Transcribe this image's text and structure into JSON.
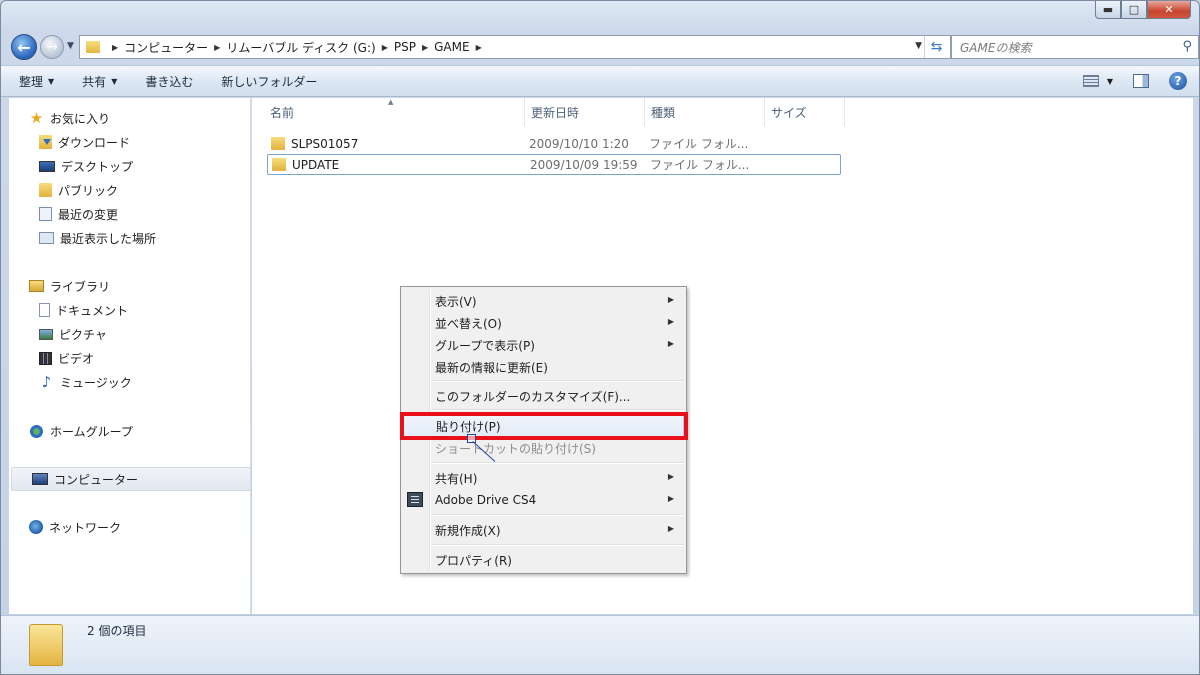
{
  "window": {
    "caption": {
      "minimize": "▬",
      "maximize": "□",
      "close": "✕"
    }
  },
  "address": {
    "crumbs": [
      "コンピューター",
      "リムーバブル ディスク (G:)",
      "PSP",
      "GAME"
    ],
    "search_placeholder": "GAMEの検索"
  },
  "toolbar": {
    "organize": "整理",
    "share": "共有",
    "burn": "書き込む",
    "new_folder": "新しいフォルダー"
  },
  "navpane": {
    "favorites": {
      "label": "お気に入り",
      "items": [
        "ダウンロード",
        "デスクトップ",
        "パブリック",
        "最近の変更",
        "最近表示した場所"
      ]
    },
    "libraries": {
      "label": "ライブラリ",
      "items": [
        "ドキュメント",
        "ピクチャ",
        "ビデオ",
        "ミュージック"
      ]
    },
    "homegroup": "ホームグループ",
    "computer": "コンピューター",
    "network": "ネットワーク"
  },
  "columns": {
    "name": "名前",
    "date": "更新日時",
    "type": "種類",
    "size": "サイズ"
  },
  "files": [
    {
      "name": "SLPS01057",
      "date": "2009/10/10 1:20",
      "type": "ファイル フォル..."
    },
    {
      "name": "UPDATE",
      "date": "2009/10/09 19:59",
      "type": "ファイル フォル..."
    }
  ],
  "status": {
    "count": "2 個の項目"
  },
  "context_menu": {
    "view": "表示(V)",
    "sort": "並べ替え(O)",
    "group": "グループで表示(P)",
    "refresh": "最新の情報に更新(E)",
    "customize": "このフォルダーのカスタマイズ(F)...",
    "paste": "貼り付け(P)",
    "paste_shortcut": "ショートカットの貼り付け(S)",
    "share": "共有(H)",
    "adobe": "Adobe Drive CS4",
    "new": "新規作成(X)",
    "properties": "プロパティ(R)"
  },
  "colors": {
    "highlight_box": "#e8101a",
    "accent": "#2f6dc2"
  }
}
